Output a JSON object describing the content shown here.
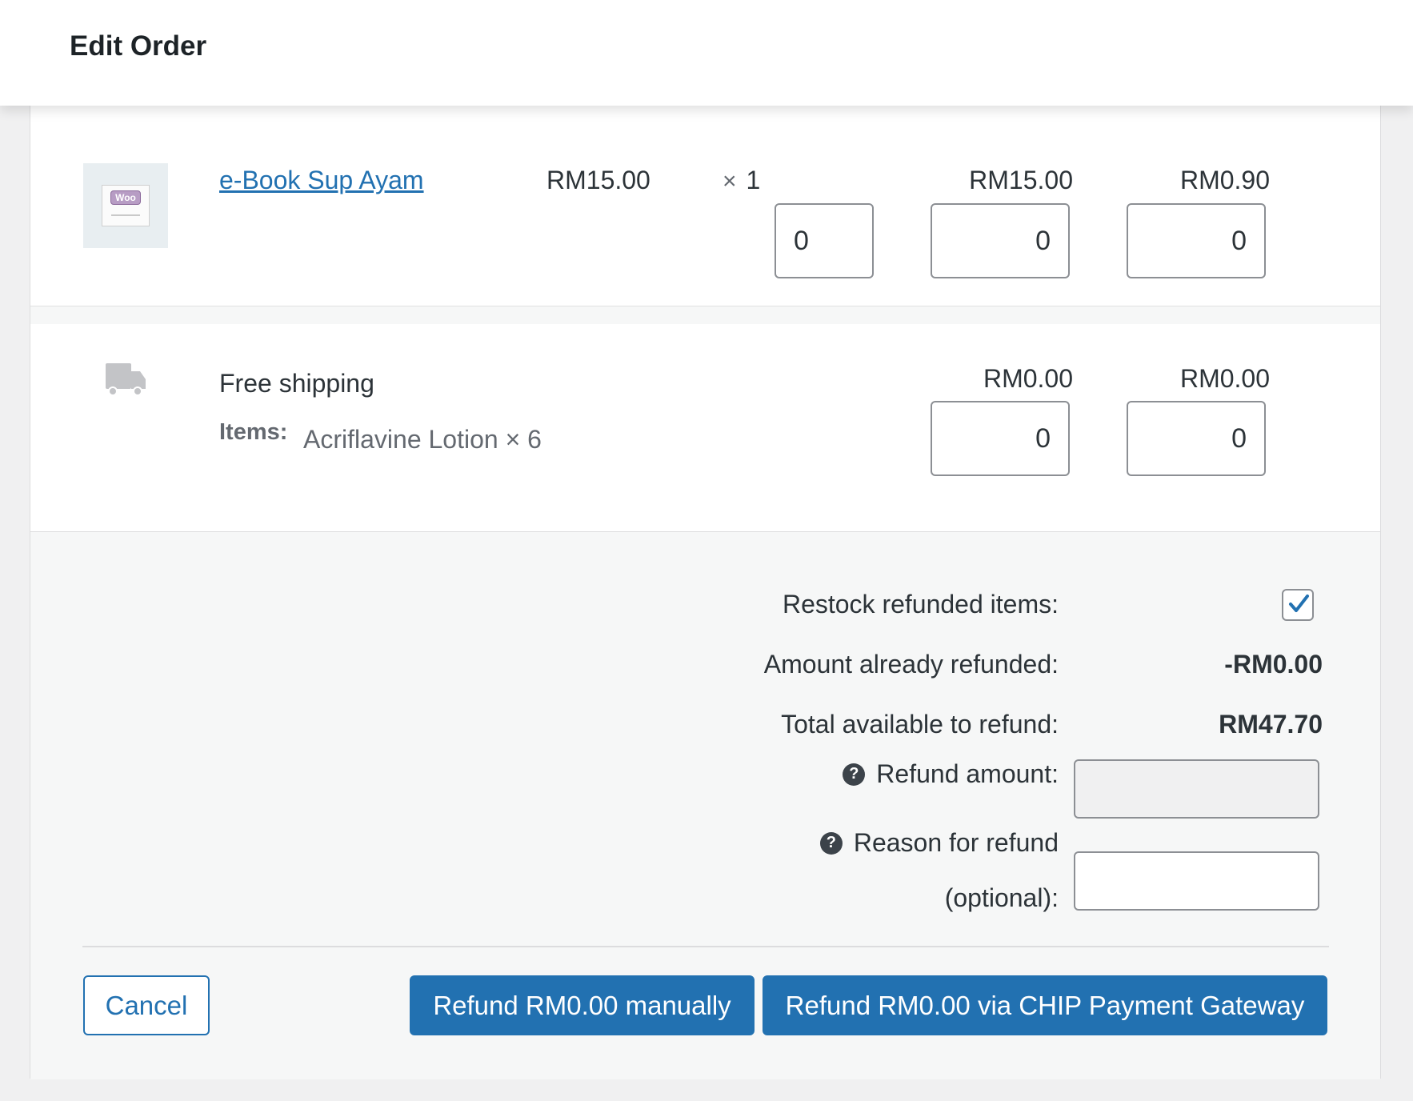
{
  "header": {
    "title": "Edit Order"
  },
  "line_item": {
    "name": "e-Book Sup Ayam",
    "thumbnail_badge": "Woo",
    "unit_cost": "RM15.00",
    "qty_prefix": "×",
    "qty": "1",
    "line_total": "RM15.00",
    "tax": "RM0.90",
    "refund_qty": "0",
    "refund_total": "0",
    "refund_tax": "0"
  },
  "shipping": {
    "icon": "truck-icon",
    "name": "Free shipping",
    "items_key": "Items:",
    "items_value": "Acriflavine Lotion × 6",
    "total": "RM0.00",
    "tax": "RM0.00",
    "refund_total": "0",
    "refund_tax": "0"
  },
  "refund": {
    "restock_label": "Restock refunded items:",
    "restock_checked": true,
    "already_refunded_label": "Amount already refunded:",
    "already_refunded_value": "-RM0.00",
    "available_label": "Total available to refund:",
    "available_value": "RM47.70",
    "amount_label": "Refund amount:",
    "amount_value": "",
    "reason_label_line1": "Reason for refund",
    "reason_label_line2": "(optional):",
    "reason_value": ""
  },
  "actions": {
    "cancel_label": "Cancel",
    "manual_label": "Refund RM0.00 manually",
    "gateway_label": "Refund RM0.00 via CHIP Payment Gateway"
  },
  "colors": {
    "accent": "#2271b1",
    "text": "#2c3338",
    "muted": "#646970"
  }
}
